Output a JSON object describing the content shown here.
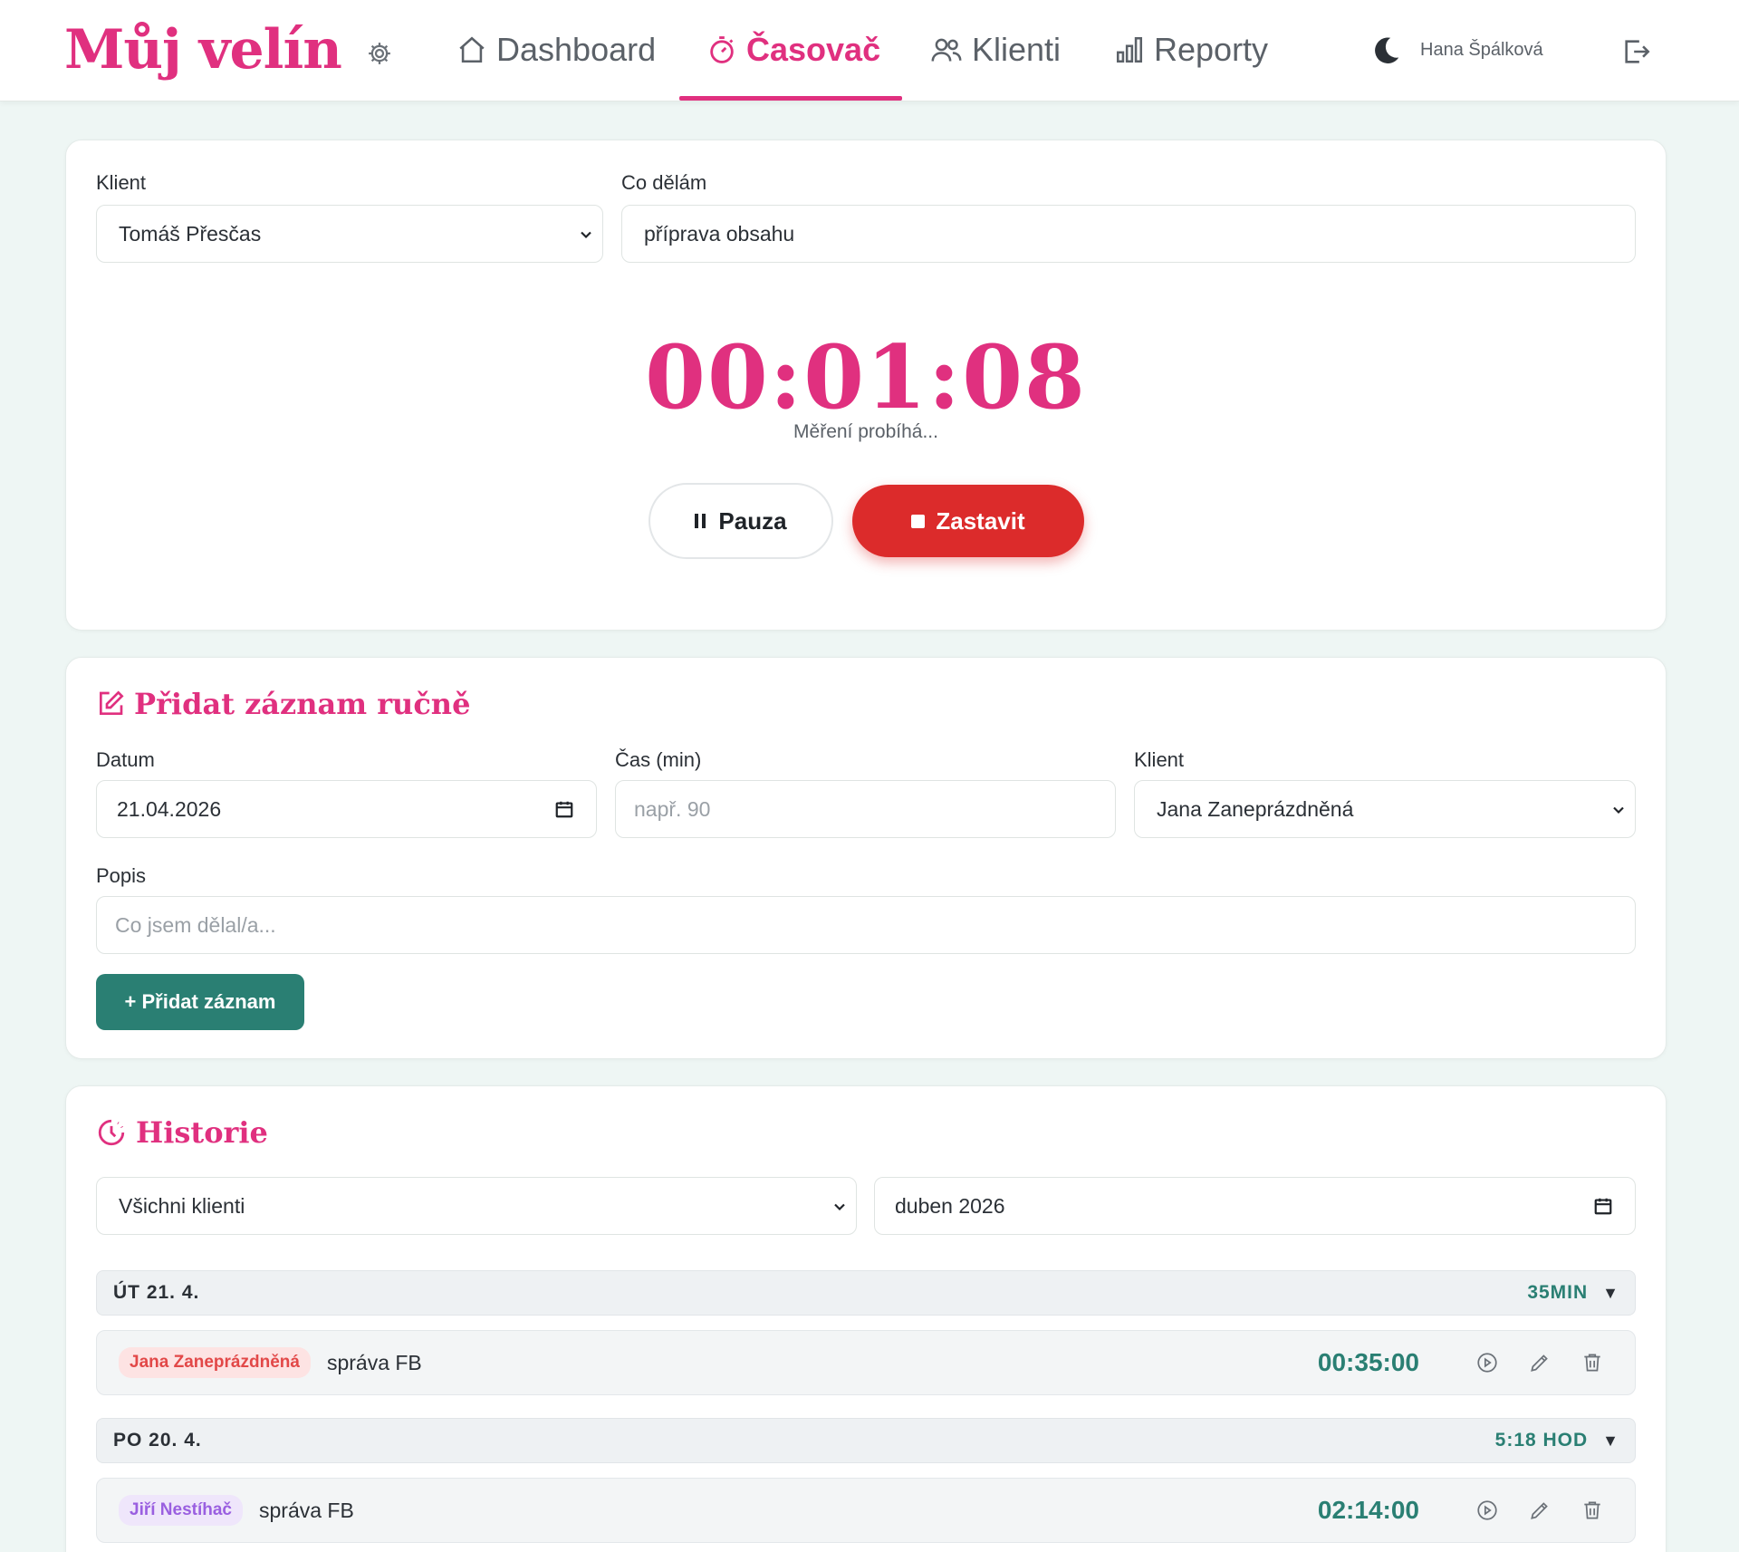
{
  "app": {
    "title": "Můj velín"
  },
  "nav": {
    "items": [
      {
        "label": "Dashboard",
        "icon": "home-icon"
      },
      {
        "label": "Časovač",
        "icon": "stopwatch-icon",
        "active": true
      },
      {
        "label": "Klienti",
        "icon": "users-icon"
      },
      {
        "label": "Reporty",
        "icon": "bar-chart-icon"
      }
    ]
  },
  "user": {
    "name": "Hana Špálková"
  },
  "timer_card": {
    "client_label": "Klient",
    "client_value": "Tomáš Přesčas",
    "task_label": "Co dělám",
    "task_value": "příprava obsahu",
    "time": "00:01:08",
    "status": "Měření probíhá...",
    "pause_label": "Pauza",
    "stop_label": "Zastavit"
  },
  "manual": {
    "title": "Přidat záznam ručně",
    "date_label": "Datum",
    "date_value": "21.04.2026",
    "minutes_label": "Čas (min)",
    "minutes_placeholder": "např. 90",
    "client_label": "Klient",
    "client_value": "Jana Zaneprázdněná",
    "desc_label": "Popis",
    "desc_placeholder": "Co jsem dělal/a...",
    "add_label": "+ Přidat záznam"
  },
  "history": {
    "title": "Historie",
    "filter_client": "Všichni klienti",
    "filter_month": "duben 2026",
    "days": [
      {
        "label": "ÚT 21. 4.",
        "total": "35MIN",
        "entries": [
          {
            "client": "Jana Zaneprázdněná",
            "desc": "správa FB",
            "time": "00:35:00"
          }
        ]
      },
      {
        "label": "PO 20. 4.",
        "total": "5:18 HOD",
        "entries": [
          {
            "client": "Jiří Nestíhač",
            "desc": "správa FB",
            "time": "02:14:00"
          }
        ]
      }
    ]
  },
  "colors": {
    "accent": "#e0307f",
    "teal": "#2a7f73",
    "danger": "#dc2b2b",
    "background": "#eef6f4"
  }
}
